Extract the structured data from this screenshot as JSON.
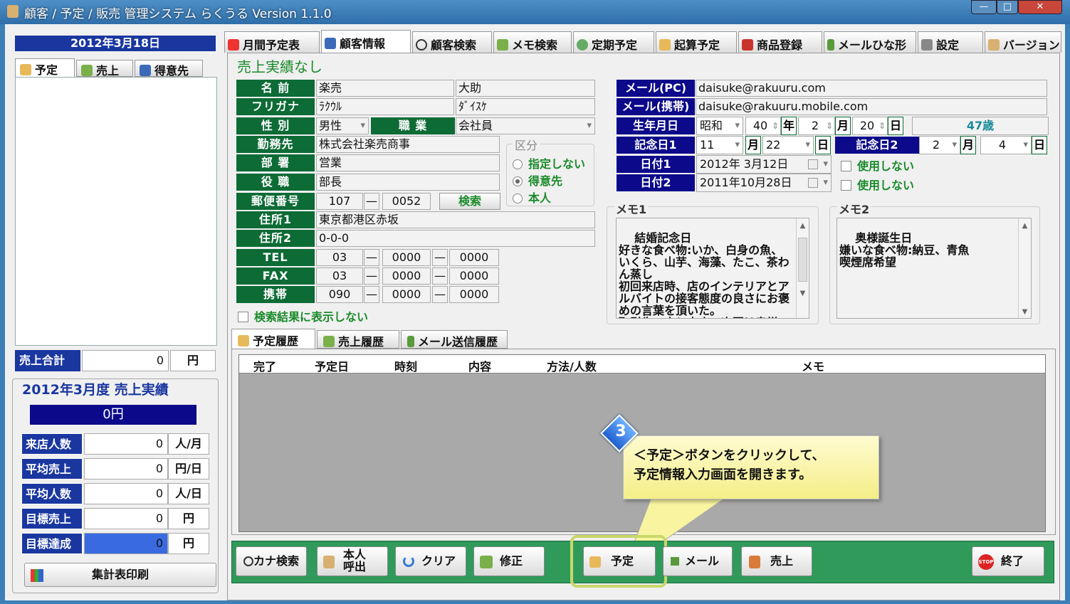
{
  "window": {
    "title": "顧客 / 予定 / 販売 管理システム らくうる  Version 1.1.0",
    "minimize": "—",
    "maximize": "□",
    "close": "✕"
  },
  "left": {
    "date": "2012年3月18日",
    "tabs": [
      "予定",
      "売上",
      "得意先"
    ],
    "sales_total_label": "売上合計",
    "sales_total_value": "0",
    "sales_total_unit": "円",
    "month_title": "2012年3月度 売上実績",
    "month_value": "0円",
    "stats": [
      {
        "label": "来店人数",
        "value": "0",
        "unit": "人/月"
      },
      {
        "label": "平均売上",
        "value": "0",
        "unit": "円/日"
      },
      {
        "label": "平均人数",
        "value": "0",
        "unit": "人/日"
      },
      {
        "label": "目標売上",
        "value": "0",
        "unit": "円"
      },
      {
        "label": "目標達成",
        "value": "0",
        "unit": "円"
      }
    ],
    "print_button": "集計表印刷"
  },
  "tabs": [
    "月間予定表",
    "顧客情報",
    "顧客検索",
    "メモ検索",
    "定期予定",
    "起算予定",
    "商品登録",
    "メールひな形",
    "設定",
    "バージョン"
  ],
  "customer": {
    "heading": "売上実績なし",
    "labels": {
      "name": "名 前",
      "furigana": "フリガナ",
      "gender": "性 別",
      "job": "職 業",
      "company": "勤務先",
      "dept": "部 署",
      "position": "役 職",
      "zip": "郵便番号",
      "addr1": "住所1",
      "addr2": "住所2",
      "tel": "TEL",
      "fax": "FAX",
      "mobile": "携帯"
    },
    "last_name": "楽売",
    "first_name": "大助",
    "kana_last": "ﾗｸｳﾙ",
    "kana_first": "ﾀﾞｲｽｹ",
    "gender": "男性",
    "job": "会社員",
    "company": "株式会社楽売商事",
    "dept": "営業",
    "position": "部長",
    "zip1": "107",
    "zip2": "0052",
    "zip_search": "検索",
    "dash": "—",
    "addr1": "東京都港区赤坂",
    "addr2": "0-0-0",
    "tel": [
      "03",
      "0000",
      "0000"
    ],
    "fax": [
      "03",
      "0000",
      "0000"
    ],
    "mobile": [
      "090",
      "0000",
      "0000"
    ],
    "category_title": "区分",
    "category_options": [
      "指定しない",
      "得意先",
      "本人"
    ],
    "hide_in_search": "検索結果に表示しない"
  },
  "right": {
    "mail_pc_label": "メール(PC)",
    "mail_pc": "daisuke@rakuuru.com",
    "mail_mobile_label": "メール(携帯)",
    "mail_mobile": "daisuke@rakuuru.mobile.com",
    "birth_label": "生年月日",
    "era": "昭和",
    "year": "40",
    "year_unit": "年",
    "month": "2",
    "month_unit": "月",
    "day": "20",
    "day_unit": "日",
    "age": "47歳",
    "anniv1_label": "記念日1",
    "anniv1_month": "11",
    "anniv1_day": "22",
    "anniv2_label": "記念日2",
    "anniv2_month": "2",
    "anniv2_day": "4",
    "date1_label": "日付1",
    "date1": "2012年 3月12日",
    "date1_unused": "使用しない",
    "date2_label": "日付2",
    "date2": "2011年10月28日",
    "date2_unused": "使用しない",
    "memo1_title": "メモ1",
    "memo1": "結婚記念日\n好きな食べ物:いか、白身の魚、いくら、山芋、海藻、たこ、茶わん蒸し\n初回来店時、店のインテリアとアルバイトの接客態度の良さにお褒めの言葉を頂いた。\n取引先の方と来店。次回は奥様",
    "memo2_title": "メモ2",
    "memo2": "奥様誕生日\n嫌いな食べ物:納豆、青魚\n喫煙席希望"
  },
  "history": {
    "tabs": [
      "予定履歴",
      "売上履歴",
      "メール送信履歴"
    ],
    "columns": [
      "完了",
      "予定日",
      "時刻",
      "内容",
      "方法/人数",
      "メモ"
    ]
  },
  "buttons": {
    "kana": "カナ検索",
    "self_call": "本人\n呼出",
    "clear": "クリア",
    "edit": "修正",
    "schedule": "予定",
    "mail": "メール",
    "sales": "売上",
    "exit": "終了"
  },
  "callout": {
    "step": "3",
    "text": "＜予定＞ボタンをクリックして、\n予定情報入力画面を開きます。"
  },
  "colors": {
    "label_green": "#0d6b36",
    "label_blue": "#0c0a8a",
    "bottom_bar": "#2f9a5a",
    "callout_bg": "#f8f4a0",
    "highlight": "#c8d86a"
  }
}
